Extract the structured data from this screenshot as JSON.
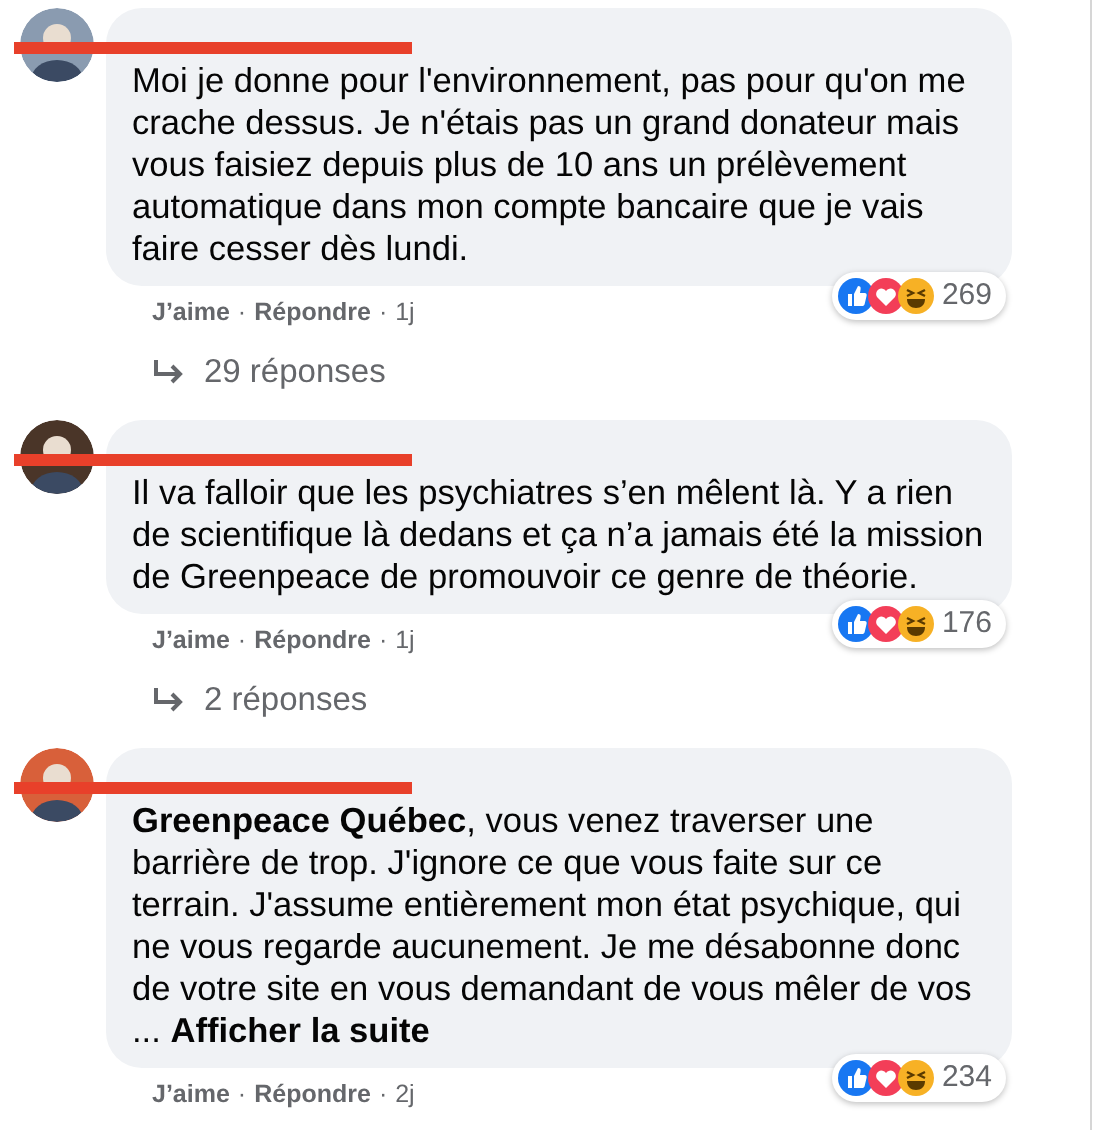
{
  "comments": [
    {
      "text": "Moi je donne pour l'environnement, pas pour qu'on me crache dessus. Je n'étais pas un grand donateur mais vous faisiez depuis plus de 10 ans un prélèvement automatique dans mon compte bancaire que je vais faire cesser dès lundi.",
      "meta": [
        {
          "kind": "link",
          "text": "J’aime"
        },
        {
          "kind": "dot",
          "text": "·"
        },
        {
          "kind": "link",
          "text": "Répondre"
        },
        {
          "kind": "dot",
          "text": "·"
        },
        {
          "kind": "time",
          "text": "1j"
        }
      ],
      "reaction_count": "269",
      "replies": "29 réponses"
    },
    {
      "text": "Il va falloir que les psychiatres s’en mêlent là. Y a rien de scientifique là dedans et ça n’a jamais été la mission de Greenpeace de promouvoir ce genre de théorie.",
      "meta": [
        {
          "kind": "link",
          "text": "J’aime"
        },
        {
          "kind": "dot",
          "text": "·"
        },
        {
          "kind": "link",
          "text": "Répondre"
        },
        {
          "kind": "dot",
          "text": "·"
        },
        {
          "kind": "time",
          "text": "1j"
        }
      ],
      "reaction_count": "176",
      "replies": "2 réponses"
    },
    {
      "text": "**Greenpeace Québec**, vous venez traverser une barrière de trop. J'ignore ce que vous faite sur ce terrain. J'assume entièrement mon état psychique, qui ne vous regarde aucunement. Je me désabonne donc de votre site en vous demandant de vous mêler de vos ...",
      "see_more": "Afficher la suite",
      "meta": [
        {
          "kind": "link",
          "text": "J’aime"
        },
        {
          "kind": "dot",
          "text": "·"
        },
        {
          "kind": "link",
          "text": "Répondre"
        },
        {
          "kind": "dot",
          "text": "·"
        },
        {
          "kind": "time",
          "text": "2j"
        }
      ],
      "reaction_count": "234"
    }
  ]
}
